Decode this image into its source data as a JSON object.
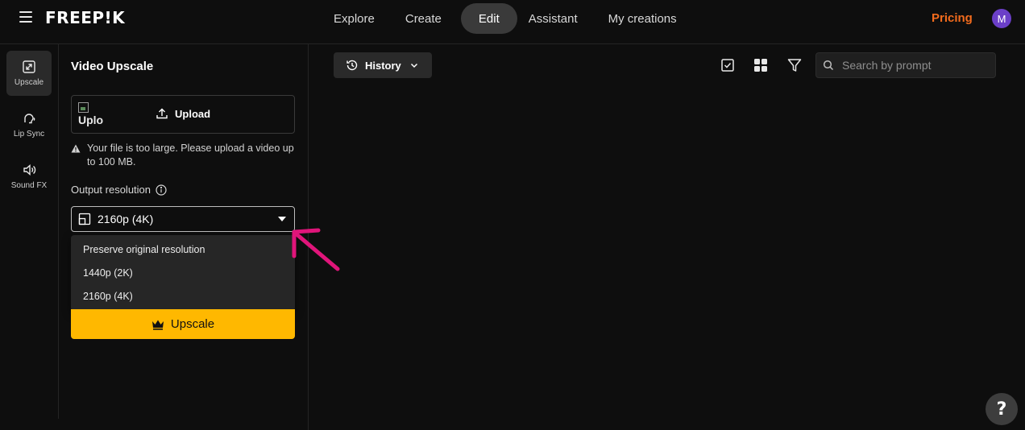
{
  "header": {
    "logo": "FREEP!K",
    "nav": [
      "Explore",
      "Create",
      "Edit",
      "Assistant",
      "My creations"
    ],
    "active_nav": "Edit",
    "pricing_label": "Pricing",
    "avatar_initial": "M",
    "colors": {
      "pricing": "#f26b1d",
      "avatar": "#6b3fc8"
    }
  },
  "tools": [
    {
      "label": "Upscale",
      "icon": "upscale-icon",
      "active": true
    },
    {
      "label": "Lip Sync",
      "icon": "lip-sync-icon",
      "active": false
    },
    {
      "label": "Sound FX",
      "icon": "speaker-icon",
      "active": false
    }
  ],
  "panel": {
    "title": "Video Upscale",
    "upload_image_alt": "Uplo",
    "upload_label": "Upload",
    "warning": "Your file is too large. Please upload a video up to 100 MB.",
    "resolution_label": "Output resolution",
    "selected_resolution": "2160p (4K)",
    "resolution_options": [
      "Preserve original resolution",
      "1440p (2K)",
      "2160p (4K)"
    ],
    "upscale_label": "Upscale",
    "colors": {
      "upscale_button": "#ffb800",
      "annotation_arrow": "#e0157a"
    }
  },
  "toolbar": {
    "history_label": "History",
    "search_placeholder": "Search by prompt"
  },
  "help_label": "?"
}
